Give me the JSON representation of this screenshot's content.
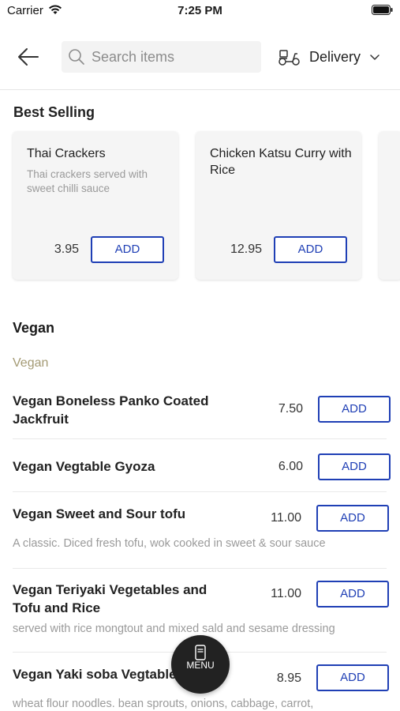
{
  "status_bar": {
    "carrier": "Carrier",
    "time": "7:25 PM"
  },
  "header": {
    "search_placeholder": "Search items",
    "delivery_label": "Delivery"
  },
  "best_selling": {
    "title": "Best Selling",
    "cards": [
      {
        "name": "Thai Crackers",
        "description": "Thai crackers served with sweet chilli sauce",
        "price": "3.95",
        "add_label": "ADD"
      },
      {
        "name": "Chicken Katsu Curry with Rice",
        "description": "",
        "price": "12.95",
        "add_label": "ADD"
      }
    ]
  },
  "vegan": {
    "title": "Vegan",
    "subtitle": "Vegan",
    "items": [
      {
        "name": "Vegan Boneless Panko Coated Jackfruit",
        "price": "7.50",
        "description": "",
        "add_label": "ADD"
      },
      {
        "name": "Vegan Vegtable Gyoza",
        "price": "6.00",
        "description": "",
        "add_label": "ADD"
      },
      {
        "name": "Vegan Sweet and Sour tofu",
        "price": "11.00",
        "description": "A classic. Diced fresh tofu, wok cooked in sweet & sour sauce",
        "add_label": "ADD"
      },
      {
        "name": "Vegan Teriyaki Vegetables and Tofu and Rice",
        "price": "11.00",
        "description": "served with rice mongtout and mixed sald and sesame dressing",
        "add_label": "ADD"
      },
      {
        "name": "Vegan Yaki soba Vegtables",
        "price": "8.95",
        "description": "wheat flour noodles. bean sprouts, onions, cabbage, carrot,",
        "add_label": "ADD"
      }
    ]
  },
  "menu_fab": {
    "label": "MENU"
  },
  "colors": {
    "accent": "#1f3fb5",
    "subsection": "#a49a74",
    "fab": "#222222"
  }
}
